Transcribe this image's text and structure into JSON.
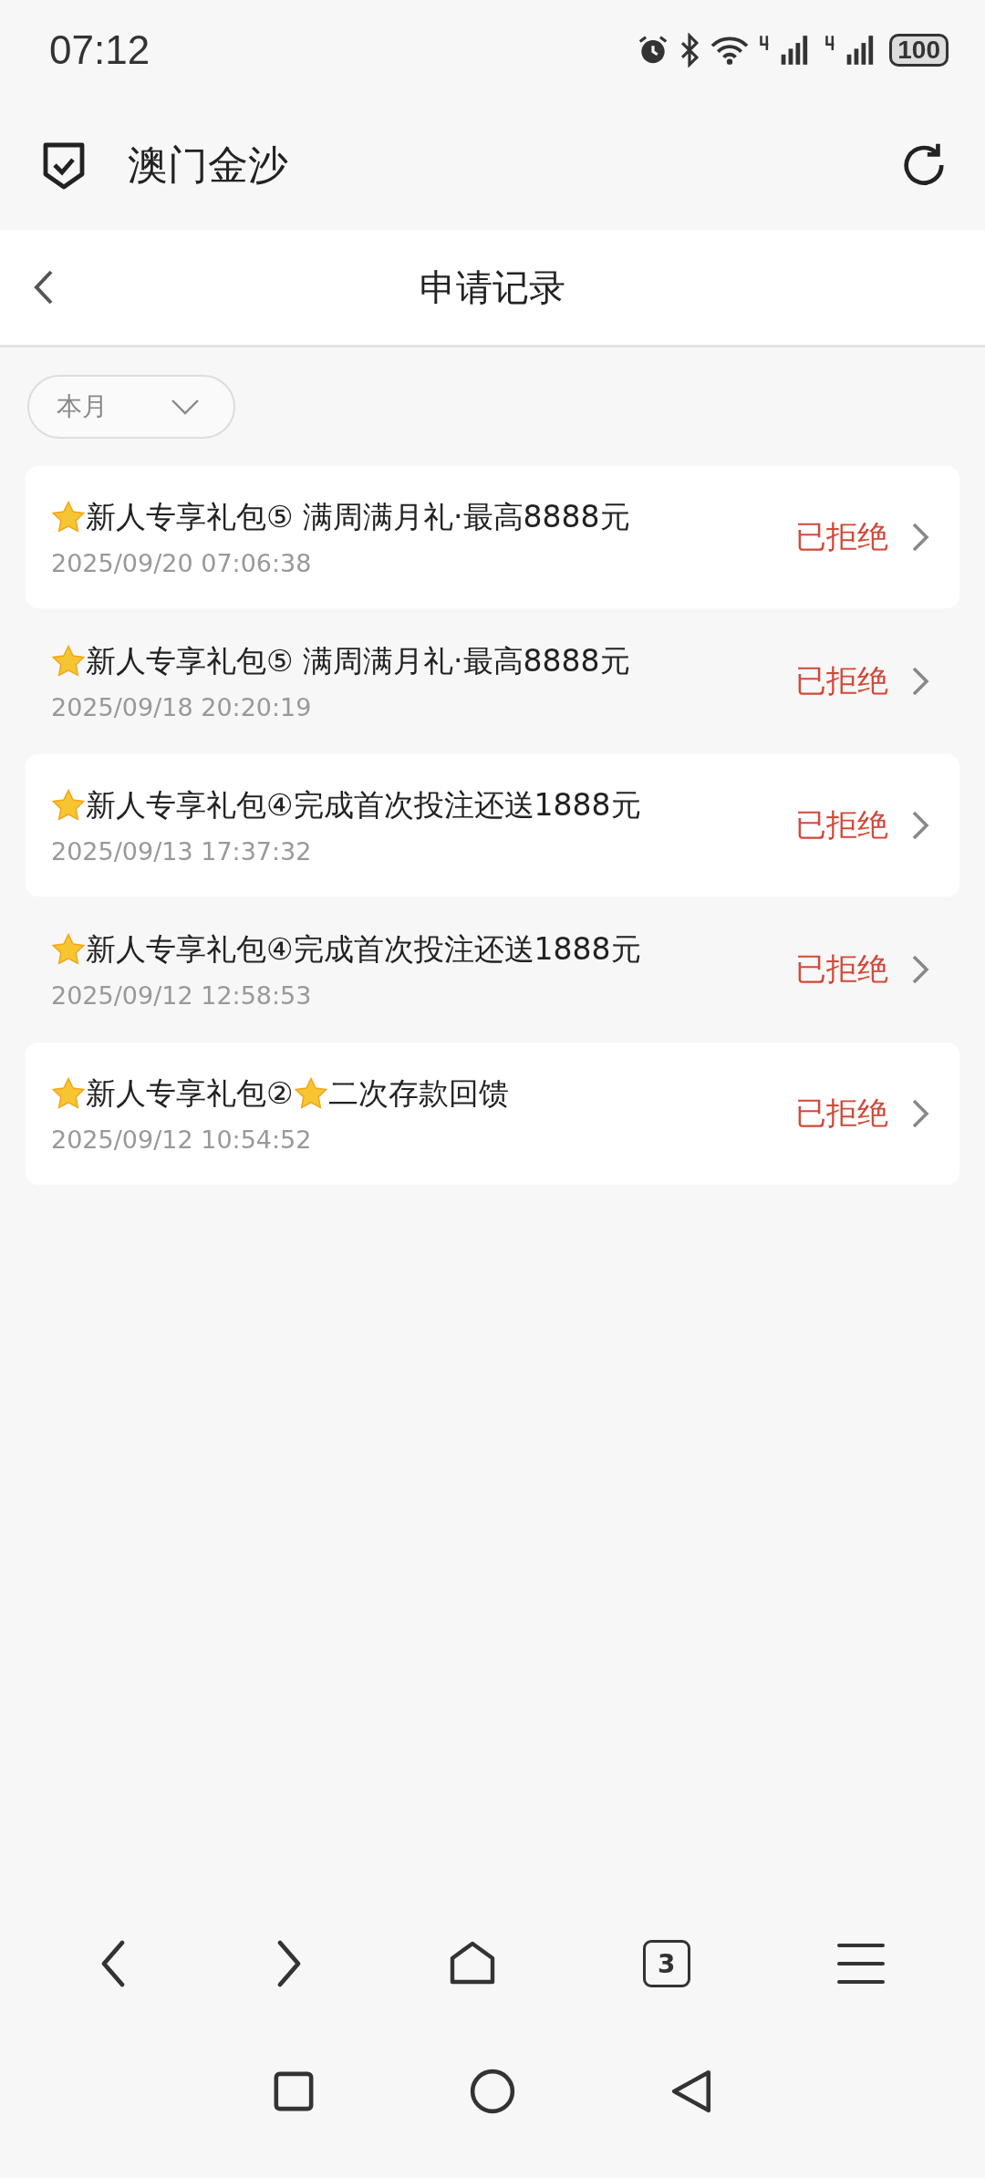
{
  "status_bar": {
    "time": "07:12",
    "battery": "100"
  },
  "browser_header": {
    "title": "澳门金沙"
  },
  "page_header": {
    "title": "申请记录"
  },
  "filter": {
    "value": "本月"
  },
  "records": [
    {
      "title_parts": [
        "新人专享礼包⑤ 满周满月礼·最高8888元"
      ],
      "time": "2025/09/20 07:06:38",
      "status": "已拒绝"
    },
    {
      "title_parts": [
        "新人专享礼包⑤ 满周满月礼·最高8888元"
      ],
      "time": "2025/09/18 20:20:19",
      "status": "已拒绝"
    },
    {
      "title_parts": [
        "新人专享礼包④完成首次投注还送1888元"
      ],
      "time": "2025/09/13 17:37:32",
      "status": "已拒绝"
    },
    {
      "title_parts": [
        "新人专享礼包④完成首次投注还送1888元"
      ],
      "time": "2025/09/12 12:58:53",
      "status": "已拒绝"
    },
    {
      "title_parts": [
        "新人专享礼包②",
        "二次存款回馈"
      ],
      "time": "2025/09/12 10:54:52",
      "status": "已拒绝"
    }
  ],
  "browser_nav": {
    "tab_count": "3"
  }
}
